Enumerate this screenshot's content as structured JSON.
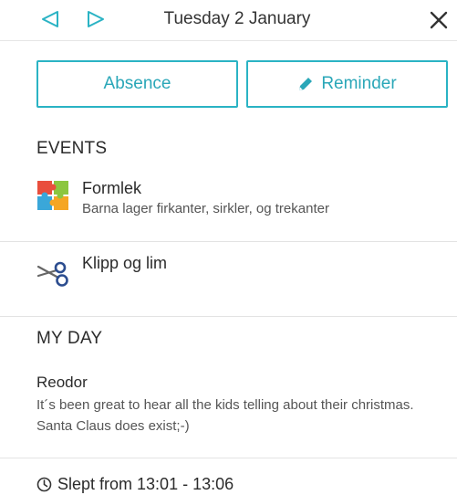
{
  "header": {
    "date": "Tuesday 2 January",
    "accent": "#2ab3c4"
  },
  "actions": {
    "absence_label": "Absence",
    "reminder_label": "Reminder",
    "reminder_icon": "pencil-icon"
  },
  "events": {
    "title": "EVENTS",
    "items": [
      {
        "title": "Formlek",
        "description": "Barna lager firkanter, sirkler, og trekanter",
        "icon": "puzzle-icon"
      },
      {
        "title": "Klipp og lim",
        "description": "",
        "icon": "scissors-icon"
      }
    ]
  },
  "my_day": {
    "title": "MY DAY",
    "author": "Reodor",
    "text": "It´s been great to hear all the kids telling about their christmas. Santa Claus does exist;-)",
    "sleep": "Slept from 13:01 - 13:06",
    "sleep_icon": "clock-icon"
  }
}
